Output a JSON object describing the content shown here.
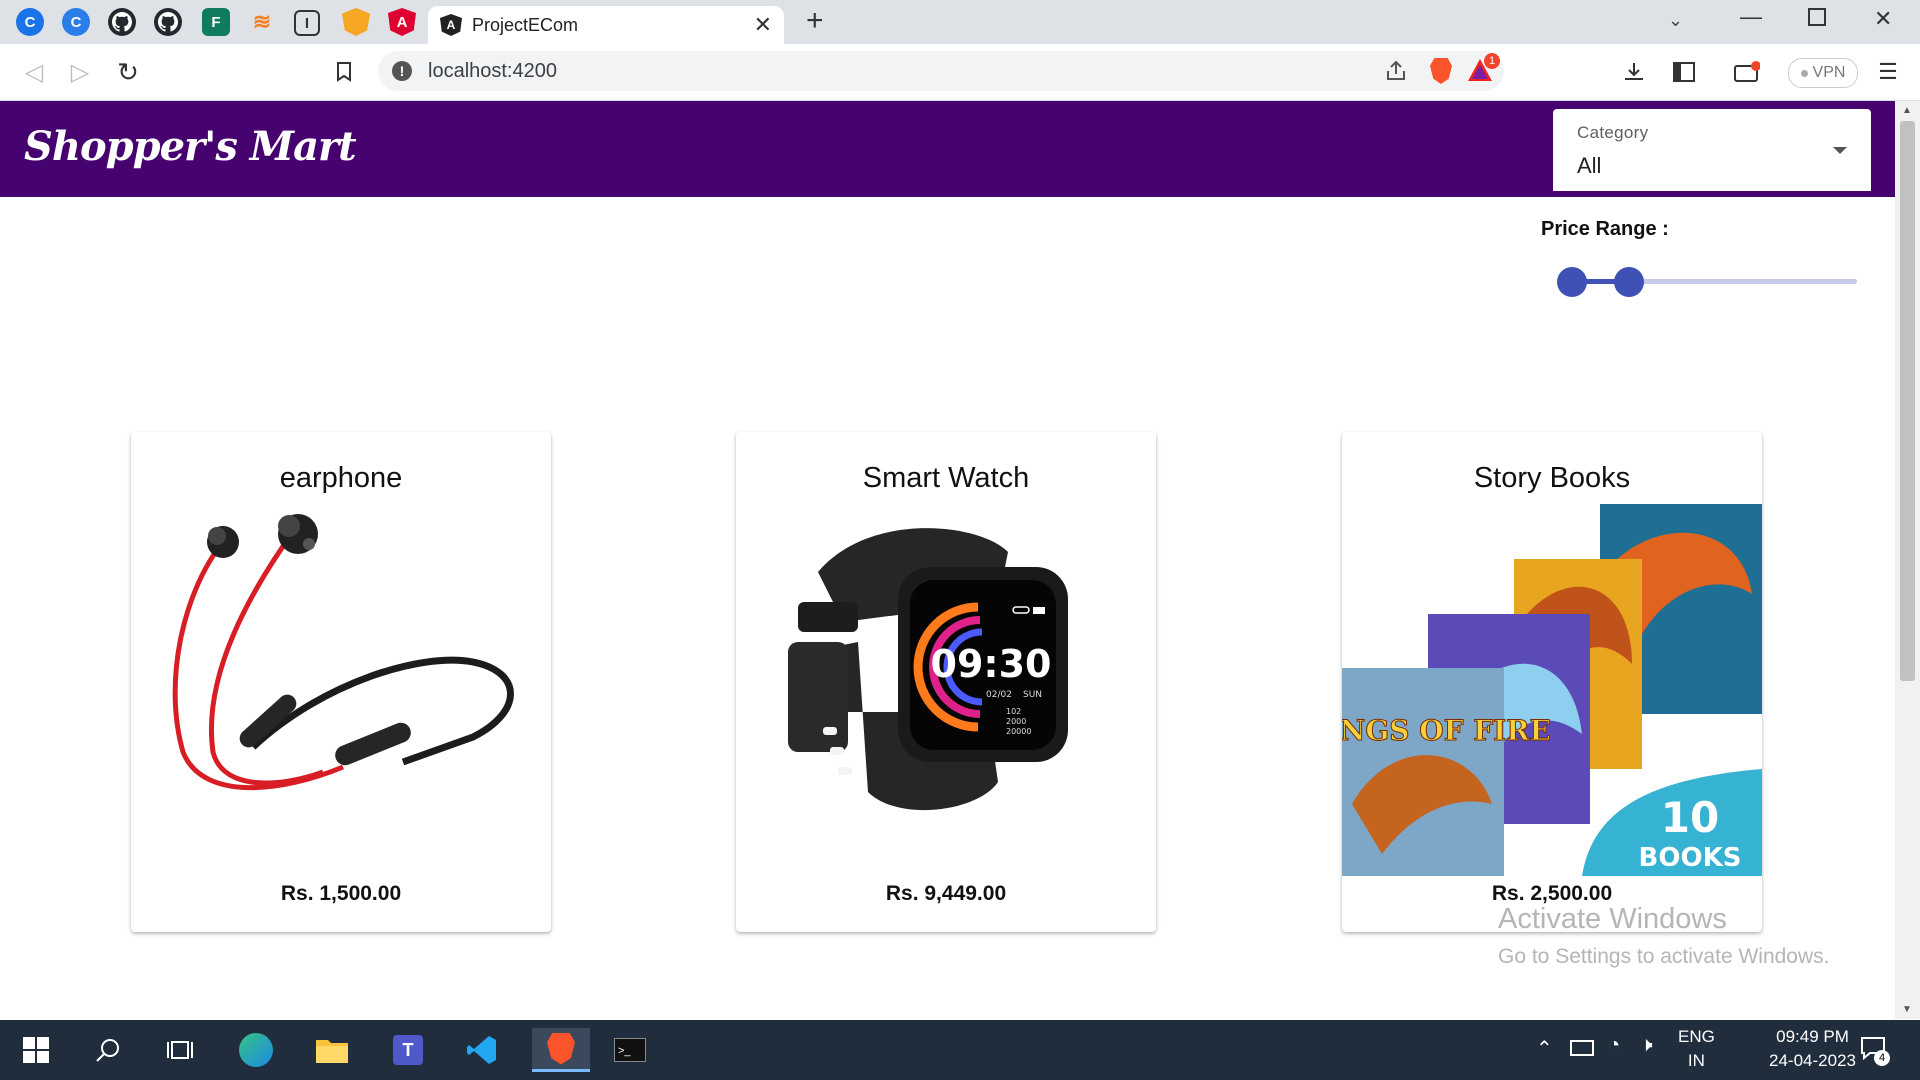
{
  "browser": {
    "active_tab_title": "ProjectECom",
    "url": "localhost:4200",
    "brave_rewards_badge": "1",
    "vpn_label": "VPN"
  },
  "app": {
    "brand": "Shopper's Mart",
    "category_label": "Category",
    "category_value": "All",
    "price_range_label": "Price Range :",
    "price_range": {
      "min_fraction": 0.0,
      "max_fraction": 0.2
    }
  },
  "products": [
    {
      "title": "earphone",
      "price": "Rs. 1,500.00",
      "image": "neckband-earphone-image"
    },
    {
      "title": "Smart Watch",
      "price": "Rs. 9,449.00",
      "image": "smart-watch-image",
      "watch_face": {
        "time": "09:30",
        "date": "02/02",
        "day": "SUN",
        "stats": [
          "102",
          "2000",
          "20000"
        ]
      }
    },
    {
      "title": "Story Books",
      "price": "Rs. 2,500.00",
      "image": "wings-of-fire-books-image",
      "book_title": "WINGS OF FIRE",
      "badge_number": "10",
      "badge_text": "BOOKS"
    }
  ],
  "watermark": {
    "line1": "Activate Windows",
    "line2": "Go to Settings to activate Windows."
  },
  "taskbar": {
    "lang1": "ENG",
    "lang2": "IN",
    "time": "09:49 PM",
    "date": "24-04-2023",
    "notification_count": "4"
  },
  "colors": {
    "header_bg": "#46036f",
    "slider_accent": "#3f51b5",
    "taskbar_bg": "#1f2d3d"
  }
}
